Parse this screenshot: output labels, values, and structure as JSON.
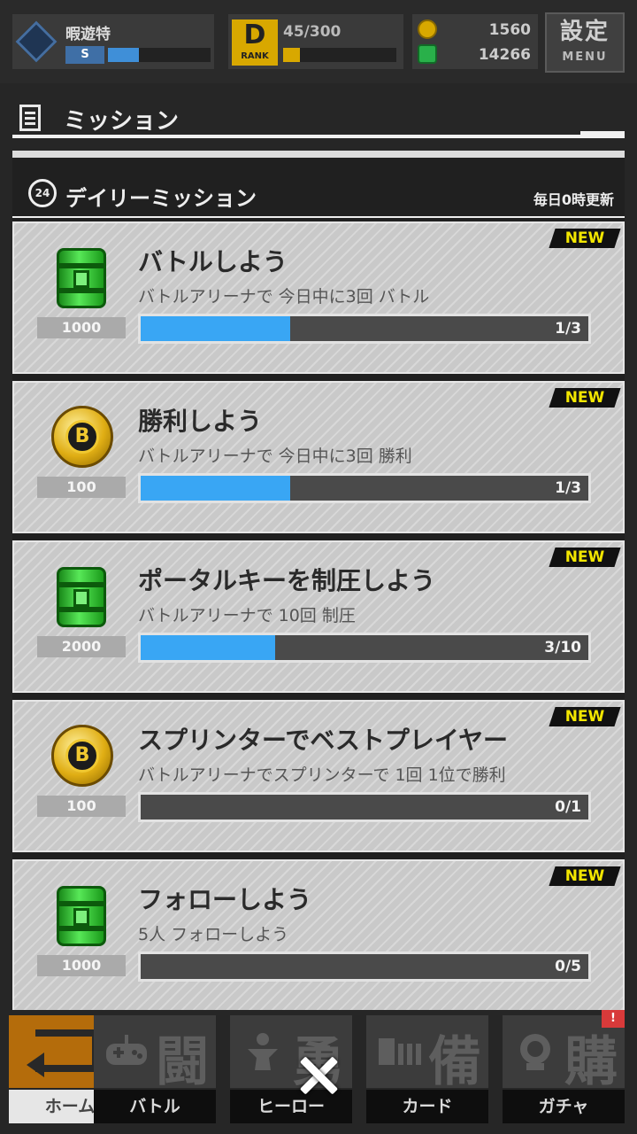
{
  "status_bar": {
    "player_name": "暇遊特",
    "player_badge": "S",
    "player_progress": 0.3,
    "rank_letter": "D",
    "rank_label": "RANK",
    "rank_exp": "45/300",
    "rank_progress": 0.15,
    "coins": "1560",
    "gems": "14266",
    "menu_jp": "設定",
    "menu_en": "MENU"
  },
  "panel": {
    "title": "ミッション",
    "section_title": "デイリーミッション",
    "section_icon_text": "24",
    "section_note": "毎日0時更新"
  },
  "missions": [
    {
      "badge": "NEW",
      "reward_icon": "green-can-icon",
      "reward_qty": "1000",
      "title": "バトルしよう",
      "desc": "バトルアリーナで 今日中に3回 バトル",
      "progress_text": "1/3",
      "progress": 0.3333
    },
    {
      "badge": "NEW",
      "reward_icon": "gold-coin-icon",
      "reward_qty": "100",
      "title": "勝利しよう",
      "desc": "バトルアリーナで 今日中に3回 勝利",
      "progress_text": "1/3",
      "progress": 0.3333
    },
    {
      "badge": "NEW",
      "reward_icon": "green-can-icon",
      "reward_qty": "2000",
      "title": "ポータルキーを制圧しよう",
      "desc": "バトルアリーナで 10回 制圧",
      "progress_text": "3/10",
      "progress": 0.3
    },
    {
      "badge": "NEW",
      "reward_icon": "gold-coin-icon",
      "reward_qty": "100",
      "title": "スプリンターでベストプレイヤー",
      "desc": "バトルアリーナでスプリンターで 1回 1位で勝利",
      "progress_text": "0/1",
      "progress": 0
    },
    {
      "badge": "NEW",
      "reward_icon": "green-can-icon",
      "reward_qty": "1000",
      "title": "フォローしよう",
      "desc": "5人 フォローしよう",
      "progress_text": "0/5",
      "progress": 0
    }
  ],
  "nav": {
    "home": {
      "label": "ホーム"
    },
    "battle": {
      "label": "バトル",
      "kanji": "闘"
    },
    "hero": {
      "label": "ヒーロー",
      "kanji": "勇"
    },
    "card": {
      "label": "カード",
      "kanji": "備"
    },
    "gacha": {
      "label": "ガチャ",
      "kanji": "購",
      "alert": "!"
    }
  },
  "colors": {
    "progress_fill": "#39a6f4",
    "new_badge_text": "#f2e600",
    "home_tab": "#f08a00"
  }
}
